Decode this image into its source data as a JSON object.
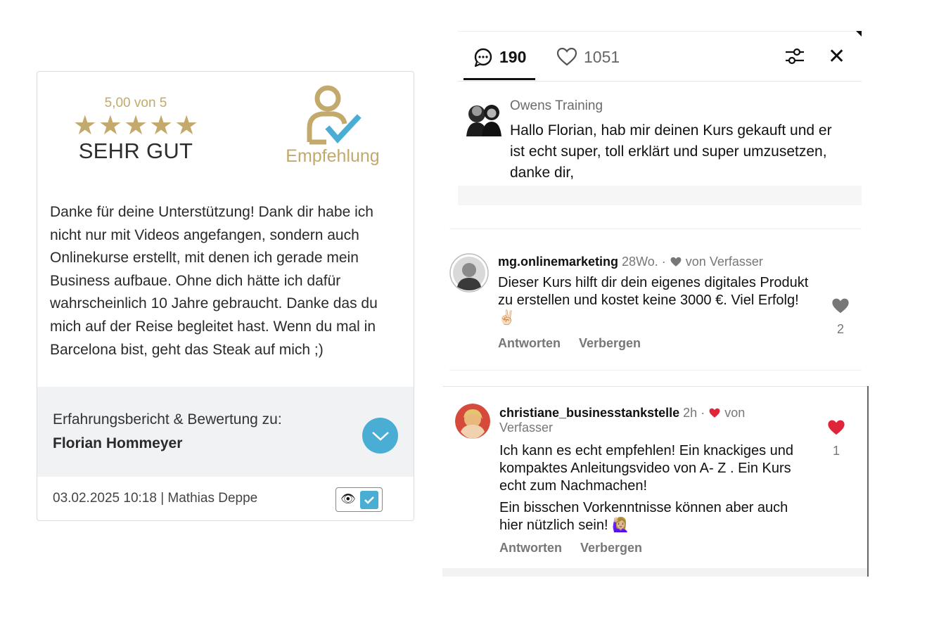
{
  "review": {
    "score_text": "5,00 von 5",
    "stars": 5,
    "grade": "SEHR GUT",
    "recommend_label": "Empfehlung",
    "text": "Danke für deine Unterstützung! Dank dir habe ich nicht nur mit Videos angefangen, sondern auch Onlinekurse erstellt, mit denen ich gerade mein Business aufbaue. Ohne dich hätte ich dafür wahrscheinlich 10 Jahre gebraucht. Danke das du mich auf der Reise begleitet hast. Wenn du mal in Barcelona bist, geht das Steak auf mich ;)",
    "about_prefix": "Erfahrungsbericht & Bewertung zu:",
    "about_name": "Florian Hommeyer",
    "meta": "03.02.2025 10:18 | Mathias Deppe",
    "colors": {
      "gold": "#c3a96b",
      "accent": "#4aaed4"
    }
  },
  "comments_panel": {
    "tabs": {
      "comments_count": "190",
      "likes_count": "1051"
    },
    "caption": {
      "author": "Owens Training",
      "text": "Hallo Florian, hab mir deinen Kurs gekauft und er ist echt super, toll erklärt und super umzusetzen, danke dir,"
    },
    "comments": [
      {
        "user": "mg.onlinemarketing",
        "time": "28Wo.",
        "dot": "·",
        "by_author": "von Verfasser",
        "text": "Dieser Kurs hilft dir dein eigenes digitales Produkt zu erstellen und kostet keine 3000 €. Viel Erfolg! ✌🏻",
        "reply": "Antworten",
        "hide": "Verbergen",
        "likes": "2",
        "like_color": "#777777"
      },
      {
        "user": "christiane_businesstankstelle",
        "time": "2h",
        "dot": "·",
        "by_author_line1": "von",
        "by_author_line2": "Verfasser",
        "text_p1": "Ich kann es echt empfehlen!  Ein knackiges und kompaktes Anleitungsvideo von A- Z . Ein Kurs echt zum Nachmachen!",
        "text_p2": "Ein bisschen Vorkenntnisse können aber auch hier nützlich sein! 🙋🏼‍♀️",
        "reply": "Antworten",
        "hide": "Verbergen",
        "likes": "1",
        "like_color": "#e0243a"
      }
    ]
  }
}
